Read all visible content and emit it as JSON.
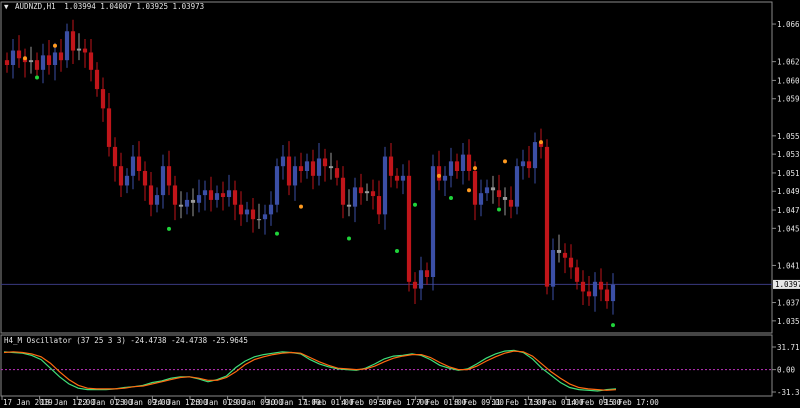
{
  "colors": {
    "background": "#000000",
    "frame": "#8a8a8a",
    "bull_candle": "#3b4fa6",
    "bear_candle": "#c0151a",
    "neutral_candle": "#9a9a9a",
    "fractal_up": "#ff9a1f",
    "fractal_down": "#1fd33a",
    "price_line": "#3a3a80",
    "osc_main": "#3fe07a",
    "osc_signal": "#ff6a10",
    "osc_zero": "#c030c0",
    "text": "#e6e6e6"
  },
  "header": {
    "marker": "▼",
    "symbol_text": "AUDNZD,H1",
    "ohlc_text": "1.03994 1.04007 1.03925 1.03973"
  },
  "price_axis": {
    "ticks": [
      "1.06675",
      "1.06285",
      "1.06090",
      "1.05900",
      "1.05515",
      "1.05325",
      "1.05130",
      "1.04940",
      "1.04745",
      "1.04555",
      "1.04170",
      "1.03785",
      "1.03595"
    ],
    "current_price": "1.03973"
  },
  "time_axis": {
    "labels": [
      "17 Jan 2019",
      "18 Jan 17:00",
      "22 Jan 01:00",
      "23 Jan 09:00",
      "24 Jan 17:00",
      "28 Jan 01:00",
      "29 Jan 09:00",
      "30 Jan 17:00",
      "1 Feb 01:00",
      "4 Feb 09:00",
      "5 Feb 17:00",
      "7 Feb 01:00",
      "8 Feb 09:00",
      "11 Feb 17:00",
      "13 Feb 01:00",
      "14 Feb 09:00",
      "15 Feb 17:00"
    ]
  },
  "oscillator": {
    "header_text": "H4_M Oscillator (37 25 3 3) -24.4738 -24.4738 -25.9645",
    "ticks": [
      "31.7145",
      "0.00",
      "-31.3653"
    ]
  },
  "chart_data": [
    {
      "type": "candlestick",
      "title": "AUDNZD,H1",
      "ohlc_last": [
        1.03994,
        1.04007,
        1.03925,
        1.03973
      ],
      "ylim": [
        1.035,
        1.068
      ],
      "close": [
        1.0625,
        1.064,
        1.0632,
        1.0628,
        1.063,
        1.062,
        1.0635,
        1.0625,
        1.0638,
        1.063,
        1.066,
        1.064,
        1.0642,
        1.0638,
        1.062,
        1.06,
        1.058,
        1.054,
        1.052,
        1.05,
        1.051,
        1.053,
        1.0515,
        1.05,
        1.048,
        1.049,
        1.052,
        1.05,
        1.048,
        1.0478,
        1.0485,
        1.0482,
        1.049,
        1.0495,
        1.0485,
        1.0492,
        1.0488,
        1.0495,
        1.048,
        1.047,
        1.0475,
        1.0465,
        1.0465,
        1.047,
        1.048,
        1.052,
        1.053,
        1.05,
        1.052,
        1.0515,
        1.0525,
        1.051,
        1.0528,
        1.052,
        1.0518,
        1.0508,
        1.048,
        1.0478,
        1.0498,
        1.0492,
        1.0494,
        1.0489,
        1.047,
        1.053,
        1.051,
        1.0505,
        1.051,
        1.04,
        1.0393,
        1.0412,
        1.0405,
        1.052,
        1.0505,
        1.051,
        1.0525,
        1.0515,
        1.0532,
        1.0515,
        1.048,
        1.0492,
        1.0498,
        1.0495,
        1.0488,
        1.0485,
        1.0478,
        1.052,
        1.0525,
        1.0518,
        1.0545,
        1.054,
        1.0395,
        1.0433,
        1.043,
        1.0425,
        1.0415,
        1.04,
        1.039,
        1.0385,
        1.04,
        1.0392,
        1.038,
        1.0397
      ],
      "fractals_up": [
        [
          3,
          1.0632
        ],
        [
          8,
          1.0645
        ],
        [
          49,
          1.0478
        ],
        [
          72,
          1.051
        ],
        [
          77,
          1.0495
        ],
        [
          78,
          1.0518
        ],
        [
          83,
          1.0525
        ],
        [
          89,
          1.0545
        ]
      ],
      "fractals_down": [
        [
          5,
          1.0612
        ],
        [
          27,
          1.0455
        ],
        [
          45,
          1.045
        ],
        [
          57,
          1.0445
        ],
        [
          65,
          1.0432
        ],
        [
          68,
          1.048
        ],
        [
          74,
          1.0487
        ],
        [
          82,
          1.0475
        ],
        [
          101,
          1.0355
        ]
      ]
    },
    {
      "type": "line",
      "title": "H4_M Oscillator (37 25 3 3)",
      "ylim": [
        -31.3653,
        31.7145
      ],
      "series": [
        {
          "values": [
            25,
            24,
            23,
            20,
            14,
            2,
            -10,
            -20,
            -26,
            -28,
            -28,
            -28,
            -27,
            -25,
            -24,
            -22,
            -18,
            -16,
            -12,
            -10,
            -10,
            -13,
            -17,
            -14,
            -9,
            3,
            12,
            18,
            21,
            23,
            25,
            24,
            22,
            14,
            8,
            4,
            1,
            0,
            -1,
            2,
            8,
            15,
            19,
            20,
            22,
            20,
            14,
            6,
            2,
            -1,
            1,
            8,
            16,
            22,
            26,
            27,
            24,
            15,
            2,
            -8,
            -18,
            -25,
            -28,
            -29,
            -30,
            -28,
            -27
          ]
        },
        {
          "values": [
            24,
            25,
            24,
            22,
            18,
            9,
            -3,
            -14,
            -22,
            -26,
            -27,
            -27,
            -27,
            -26,
            -24,
            -23,
            -20,
            -17,
            -14,
            -11,
            -10,
            -12,
            -15,
            -15,
            -11,
            -3,
            7,
            14,
            18,
            21,
            23,
            24,
            23,
            17,
            11,
            6,
            2,
            1,
            0,
            1,
            5,
            11,
            16,
            19,
            21,
            21,
            17,
            10,
            4,
            0,
            0,
            5,
            12,
            18,
            23,
            26,
            25,
            19,
            8,
            -3,
            -12,
            -20,
            -25,
            -27,
            -28,
            -29,
            -28
          ]
        }
      ]
    }
  ]
}
